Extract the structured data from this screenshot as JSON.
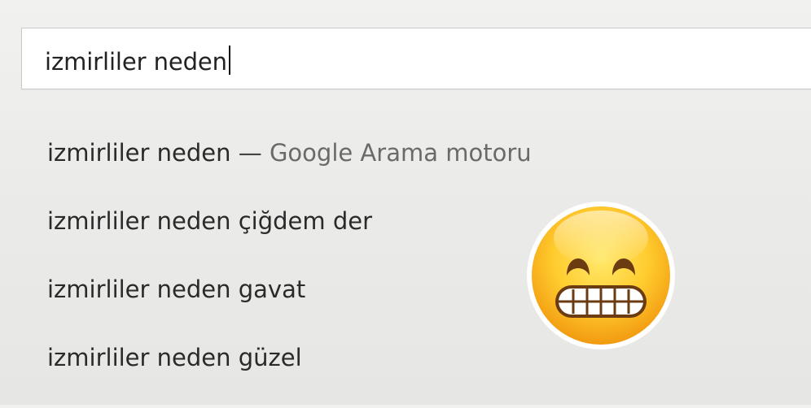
{
  "search": {
    "query": "izmirliler neden"
  },
  "suggestions": [
    {
      "text": "izmirliler neden",
      "separator": " — ",
      "engine": "Google Arama motoru"
    },
    {
      "text": "izmirliler neden çiğdem der"
    },
    {
      "text": "izmirliler neden gavat"
    },
    {
      "text": "izmirliler neden güzel"
    }
  ],
  "overlay": {
    "icon": "grimacing-face-emoji"
  }
}
